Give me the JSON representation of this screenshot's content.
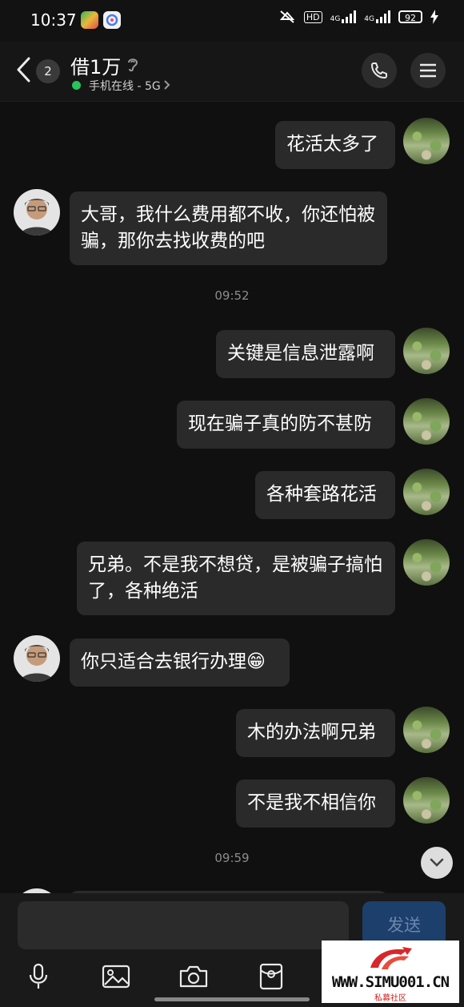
{
  "status_bar": {
    "time": "10:37",
    "hd": "HD",
    "net1": "4G",
    "net2": "4G",
    "battery": "92"
  },
  "header": {
    "unread_count": "2",
    "contact_name": "借1万",
    "online_status": "手机在线 - 5G"
  },
  "messages": [
    {
      "side": "right",
      "text": "花活太多了"
    },
    {
      "side": "left",
      "text": "大哥，我什么费用都不收，你还怕被骗，那你去找收费的吧"
    },
    {
      "type": "time",
      "text": "09:52"
    },
    {
      "side": "right",
      "text": "关键是信息泄露啊"
    },
    {
      "side": "right",
      "text": "现在骗子真的防不甚防"
    },
    {
      "side": "right",
      "text": "各种套路花活"
    },
    {
      "side": "right",
      "text": "兄弟。不是我不想贷，是被骗子搞怕了，各种绝活"
    },
    {
      "side": "left",
      "text": "你只适合去银行办理😁"
    },
    {
      "side": "right",
      "text": "木的办法啊兄弟"
    },
    {
      "side": "right",
      "text": "不是我不相信你"
    },
    {
      "type": "time",
      "text": "09:59"
    }
  ],
  "composer": {
    "input_value": "",
    "send_label": "发送"
  },
  "watermark": {
    "url": "WWW.SIMU001.CN",
    "subtitle": "私募社区"
  },
  "colors": {
    "background": "#101010",
    "bubble": "#2a2a2a",
    "online": "#27c45a",
    "send_button": "#1c3f6b"
  }
}
